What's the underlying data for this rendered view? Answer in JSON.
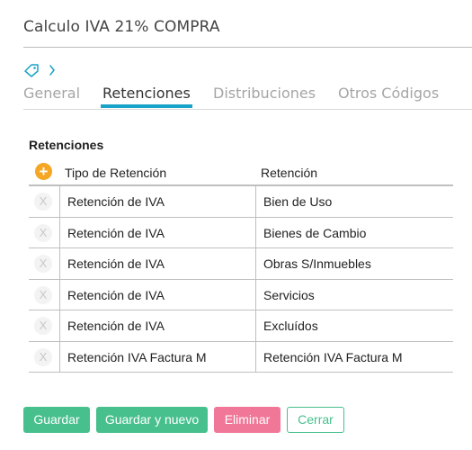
{
  "header": {
    "title": "Calculo IVA 21% COMPRA"
  },
  "breadcrumb": {
    "icons": [
      "tag-icon",
      "chevron-right-icon"
    ]
  },
  "tabs": [
    {
      "label": "General",
      "active": false
    },
    {
      "label": "Retenciones",
      "active": true
    },
    {
      "label": "Distribuciones",
      "active": false
    },
    {
      "label": "Otros Códigos",
      "active": false
    }
  ],
  "section": {
    "title": "Retenciones"
  },
  "table": {
    "add_icon": "+",
    "remove_icon": "X",
    "columns": [
      "Tipo de Retención",
      "Retención"
    ],
    "rows": [
      [
        "Retención de IVA",
        "Bien de Uso"
      ],
      [
        "Retención de IVA",
        "Bienes de Cambio"
      ],
      [
        "Retención de IVA",
        "Obras S/Inmuebles"
      ],
      [
        "Retención de IVA",
        "Servicios"
      ],
      [
        "Retención de IVA",
        "Excluídos"
      ],
      [
        "Retención IVA Factura M",
        "Retención IVA Factura M"
      ]
    ]
  },
  "actions": {
    "save": "Guardar",
    "save_new": "Guardar y nuevo",
    "delete": "Eliminar",
    "close": "Cerrar"
  },
  "colors": {
    "accent": "#1aa3c8",
    "primary": "#48c08e",
    "danger": "#f07797",
    "add": "#f5a623"
  }
}
